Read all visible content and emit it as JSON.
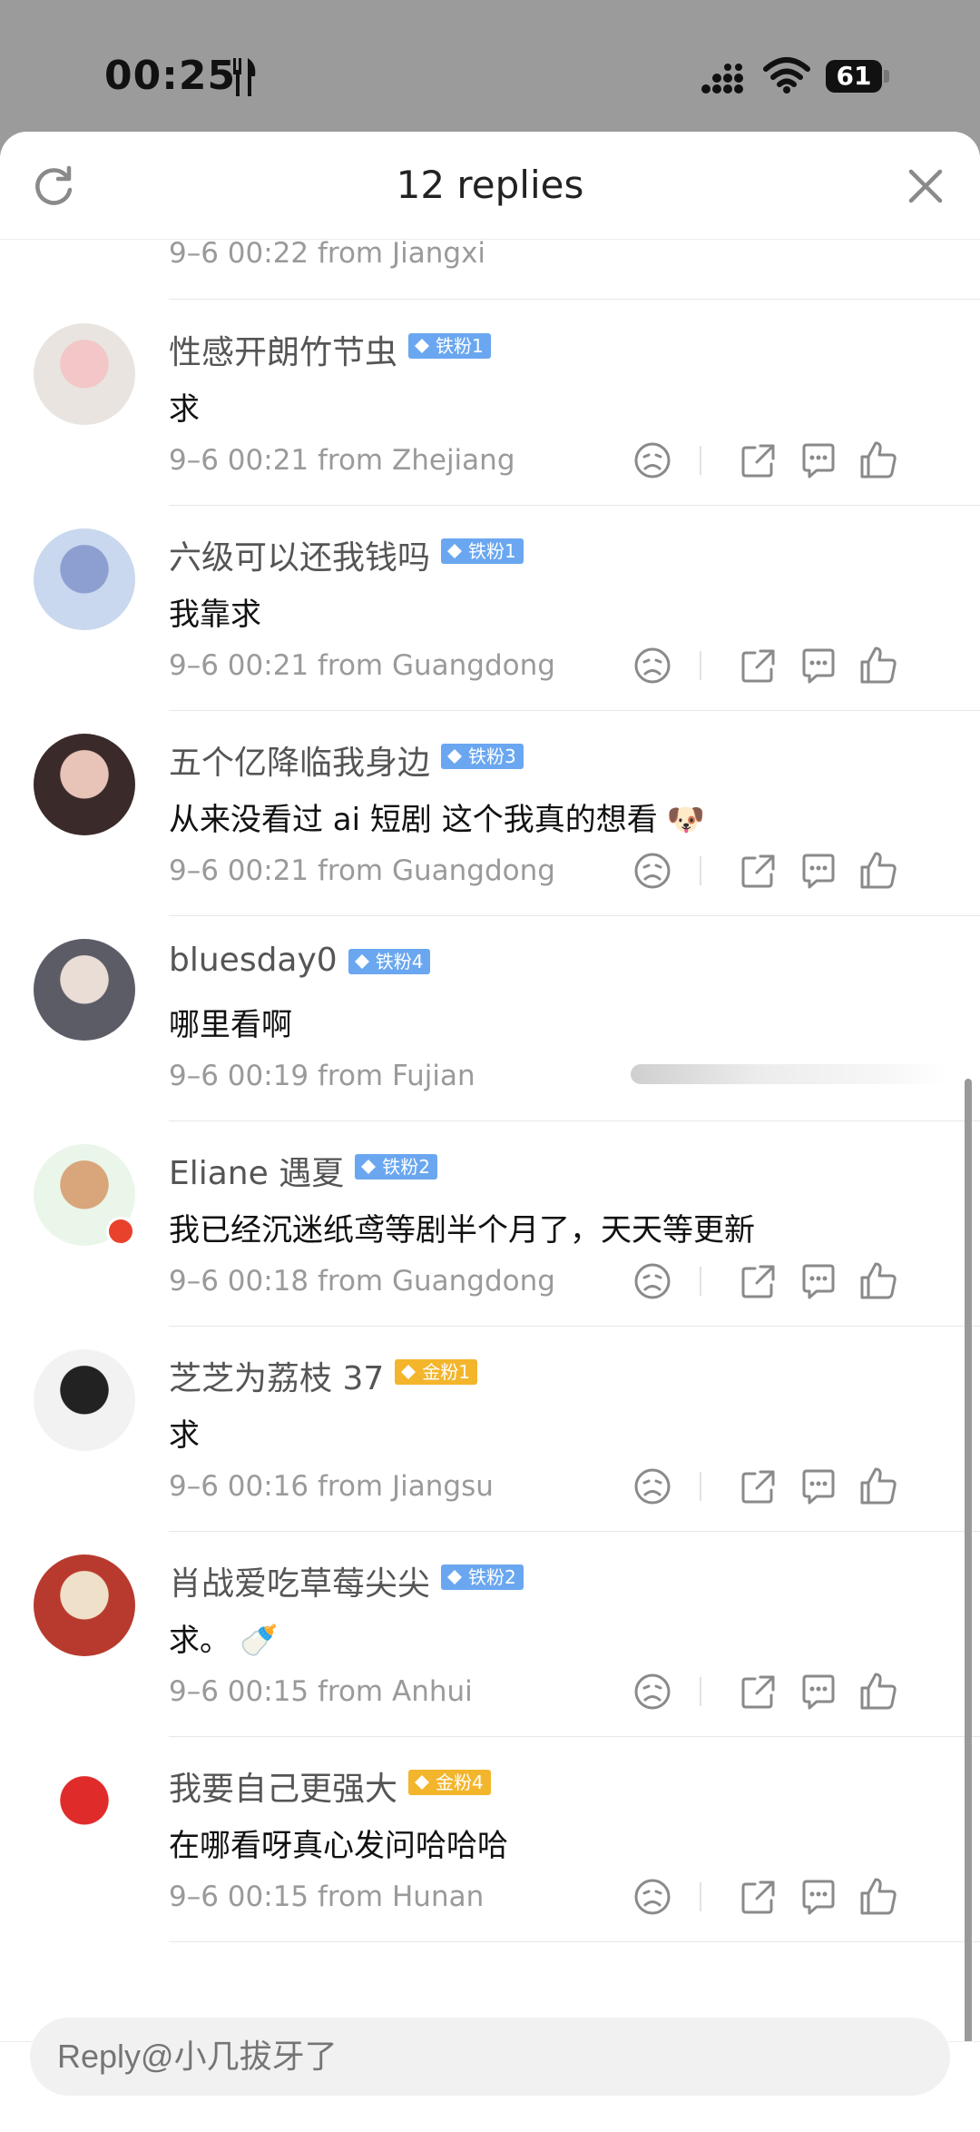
{
  "status_bar": {
    "time": "00:25",
    "battery": "61"
  },
  "header": {
    "title": "12 replies"
  },
  "partial_row": {
    "meta": "9–6 00:22 from Jiangxi"
  },
  "comments": [
    {
      "name": "性感开朗竹节虫",
      "badge": "铁粉1",
      "badge_color": "#6aa7f0",
      "text": "求",
      "meta": "9–6 00:21  from Zhejiang",
      "avatar_colors": [
        "#e9e4df",
        "#f3c7c7"
      ]
    },
    {
      "name": "六级可以还我钱吗",
      "badge": "铁粉1",
      "badge_color": "#6aa7f0",
      "text": "我靠求",
      "meta": "9–6 00:21  from Guangdong",
      "avatar_colors": [
        "#c9d8ee",
        "#8c9fd0"
      ]
    },
    {
      "name": "五个亿降临我身边",
      "badge": "铁粉3",
      "badge_color": "#6aa7f0",
      "text": "从来没看过 ai 短剧 这个我真的想看",
      "emoji": "🐶",
      "meta": "9–6 00:21  from Guangdong",
      "avatar_colors": [
        "#3a2a2a",
        "#e8c3b8"
      ]
    },
    {
      "name": "bluesday0",
      "badge": "铁粉4",
      "badge_color": "#6aa7f0",
      "text": "哪里看啊",
      "meta": "9–6 00:19  from Fujian",
      "avatar_colors": [
        "#5c5c66",
        "#e9ddd6"
      ],
      "loading": true
    },
    {
      "name": "Eliane 遇夏",
      "badge": "铁粉2",
      "badge_color": "#6aa7f0",
      "text": "我已经沉迷纸鸢等剧半个月了，天天等更新",
      "meta": "9–6 00:18  from Guangdong",
      "avatar_colors": [
        "#eaf6ea",
        "#d9a57a"
      ],
      "vip": true
    },
    {
      "name": "芝芝为荔枝 37",
      "badge": "金粉1",
      "badge_color": "#f3b52c",
      "text": "求",
      "meta": "9–6 00:16  from Jiangsu",
      "avatar_colors": [
        "#f2f2f2",
        "#222222"
      ]
    },
    {
      "name": "肖战爱吃草莓尖尖",
      "badge": "铁粉2",
      "badge_color": "#6aa7f0",
      "text": "求。",
      "emoji": "🍼",
      "meta": "9–6 00:15  from Anhui",
      "avatar_colors": [
        "#b83a2e",
        "#efe0c9"
      ]
    },
    {
      "name": "我要自己更强大",
      "badge": "金粉4",
      "badge_color": "#f3b52c",
      "text": "在哪看呀真心发问哈哈哈",
      "meta": "9–6 00:15  from Hunan",
      "avatar_colors": [
        "#ffffff",
        "#e02b2b"
      ]
    }
  ],
  "reply_box": {
    "placeholder": "Reply@小几拔牙了"
  }
}
